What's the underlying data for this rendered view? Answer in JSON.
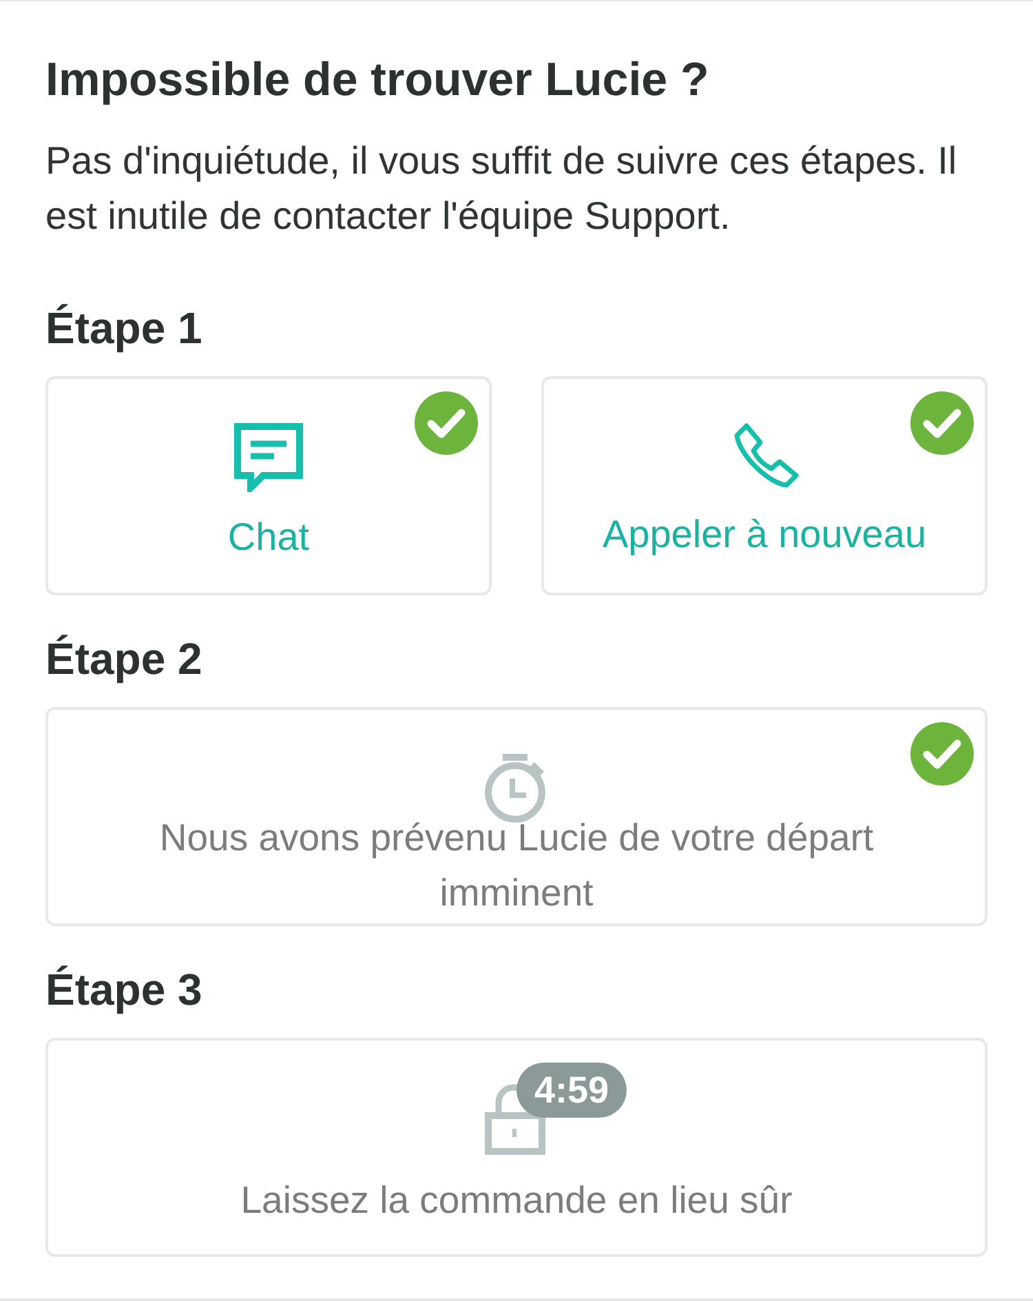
{
  "title": "Impossible de trouver Lucie ?",
  "intro": "Pas d'inquiétude, il vous suffit de suivre ces étapes. Il est inutile de contacter l'équipe Support.",
  "steps": [
    {
      "heading": "Étape 1",
      "options": [
        {
          "kind": "chat",
          "label": "Chat",
          "checked": true,
          "disabled": false
        },
        {
          "kind": "phone",
          "label": "Appeler à nouveau",
          "checked": true,
          "disabled": false
        }
      ]
    },
    {
      "heading": "Étape 2",
      "options": [
        {
          "kind": "stopwatch",
          "label": "Nous avons prévenu Lucie de votre départ imminent",
          "checked": true,
          "disabled": true
        }
      ]
    },
    {
      "heading": "Étape 3",
      "options": [
        {
          "kind": "lock",
          "label": "Laissez la commande en lieu sûr",
          "checked": false,
          "disabled": true,
          "timer": "4:59"
        }
      ]
    }
  ]
}
